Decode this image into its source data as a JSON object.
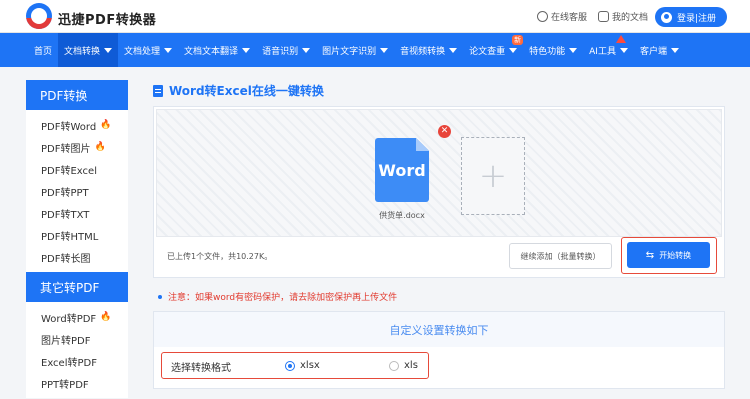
{
  "header": {
    "brand": "迅捷PDF转换器",
    "service_label": "在线客服",
    "docs_label": "我的文档",
    "login_label": "登录|注册"
  },
  "nav": {
    "items": [
      {
        "label": "首页",
        "caret": false
      },
      {
        "label": "文档转换",
        "caret": true,
        "active": true
      },
      {
        "label": "文档处理",
        "caret": true
      },
      {
        "label": "文档文本翻译",
        "caret": true
      },
      {
        "label": "语音识别",
        "caret": true
      },
      {
        "label": "图片文字识别",
        "caret": true
      },
      {
        "label": "音视频转换",
        "caret": true
      },
      {
        "label": "论文查重",
        "caret": true,
        "badge": "新"
      },
      {
        "label": "特色功能",
        "caret": true
      },
      {
        "label": "AI工具",
        "caret": true
      },
      {
        "label": "客户端",
        "caret": true
      }
    ]
  },
  "sidebar": {
    "sections": [
      {
        "title": "PDF转换",
        "items": [
          {
            "label": "PDF转Word",
            "hot": true
          },
          {
            "label": "PDF转图片",
            "hot": true
          },
          {
            "label": "PDF转Excel",
            "hot": false
          },
          {
            "label": "PDF转PPT",
            "hot": false
          },
          {
            "label": "PDF转TXT",
            "hot": false
          },
          {
            "label": "PDF转HTML",
            "hot": false
          },
          {
            "label": "PDF转长图",
            "hot": false
          }
        ]
      },
      {
        "title": "其它转PDF",
        "items": [
          {
            "label": "Word转PDF",
            "hot": true
          },
          {
            "label": "图片转PDF",
            "hot": false
          },
          {
            "label": "Excel转PDF",
            "hot": false
          },
          {
            "label": "PPT转PDF",
            "hot": false
          }
        ]
      }
    ]
  },
  "main": {
    "title": "Word转Excel在线一键转换",
    "file": {
      "icon_text": "Word",
      "name": "供货单.docx"
    },
    "status": "已上传1个文件，共10.27K。",
    "continue_label": "继续添加（批量转换）",
    "start_label": "开始转换",
    "note": "注意：如果word有密码保护，请去除加密保护再上传文件",
    "settings": {
      "heading": "自定义设置转换如下",
      "format_label": "选择转换格式",
      "options": [
        {
          "label": "xlsx",
          "checked": true
        },
        {
          "label": "xls",
          "checked": false
        }
      ]
    }
  },
  "colors": {
    "primary": "#1e74f5",
    "highlight_border": "#e64a3a",
    "note_text": "#e23a2e"
  }
}
